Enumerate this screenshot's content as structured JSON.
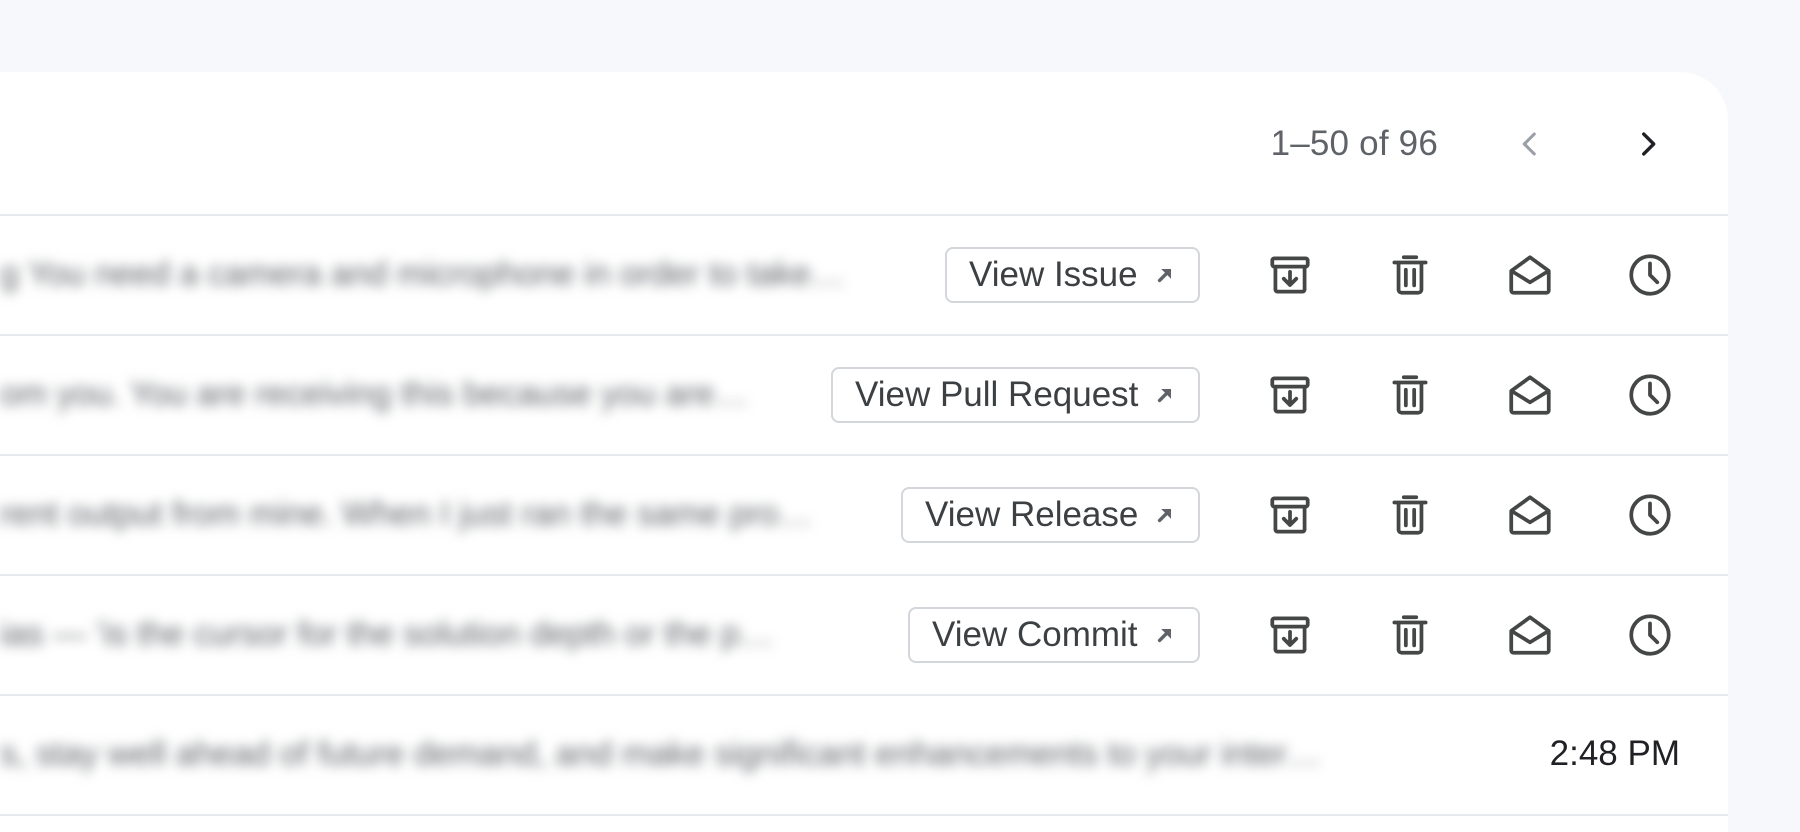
{
  "pagination": {
    "range_label": "1–50 of 96",
    "prev_icon": "chevron-left-icon",
    "next_icon": "chevron-right-icon"
  },
  "rows": [
    {
      "snippet": "g You need a camera and microphone in order to take…",
      "chip_label": "View Issue",
      "time": ""
    },
    {
      "snippet": "om you. You are receiving this because you are…",
      "chip_label": "View Pull Request",
      "time": ""
    },
    {
      "snippet": "rent output from mine. When I just ran the same pro…",
      "chip_label": "View Release",
      "time": ""
    },
    {
      "snippet": "ias — 'is the cursor for the solution depth or the p…",
      "chip_label": "View Commit",
      "time": ""
    },
    {
      "snippet": "s, stay well ahead of future demand, and make significant enhancements to your inter…",
      "chip_label": "",
      "time": "2:48 PM"
    }
  ],
  "icons": {
    "archive": "archive-icon",
    "delete": "trash-icon",
    "mark_read": "mail-open-icon",
    "snooze": "clock-icon",
    "external": "open-external-arrow-icon"
  },
  "colors": {
    "page_bg": "#f6f8fc",
    "panel_bg": "#ffffff",
    "divider": "#e6e9ee",
    "icon": "#444746"
  }
}
